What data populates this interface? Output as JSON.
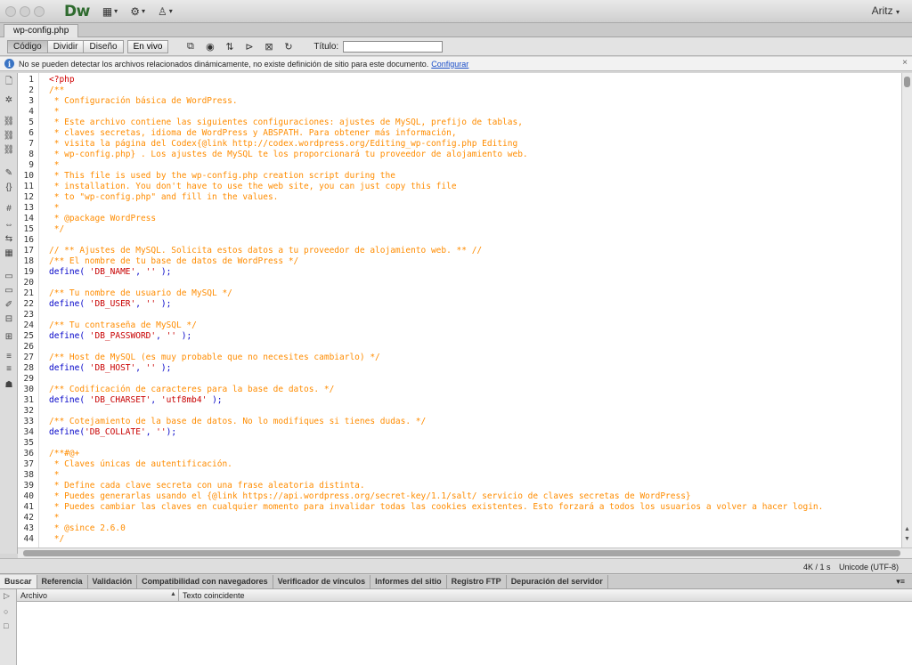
{
  "app": {
    "logo": "Dw",
    "user": "Aritz",
    "menu_glyphs": [
      "▦",
      "⚙",
      "♙"
    ],
    "caret": "▾"
  },
  "document_tab": "wp-config.php",
  "toolbar": {
    "views": [
      "Código",
      "Dividir",
      "Diseño"
    ],
    "active_view": "Código",
    "live": "En vivo",
    "title_label": "Título:",
    "title_value": "",
    "icon_glyphs": [
      "⧉",
      "◉",
      "⇅",
      "⊳",
      "⊠",
      "↻"
    ]
  },
  "infobar": {
    "icon": "i",
    "message": "No se pueden detectar los archivos relacionados dinámicamente, no existe definición de sitio para este documento.",
    "link": "Configurar",
    "close": "×"
  },
  "code_lines": [
    {
      "n": "1",
      "t": "<?php",
      "k": "php"
    },
    {
      "n": "2",
      "t": "/**",
      "k": "comment"
    },
    {
      "n": "3",
      "t": " * Configuración básica de WordPress.",
      "k": "comment"
    },
    {
      "n": "4",
      "t": " *",
      "k": "comment"
    },
    {
      "n": "5",
      "t": " * Este archivo contiene las siguientes configuraciones: ajustes de MySQL, prefijo de tablas,",
      "k": "comment"
    },
    {
      "n": "6",
      "t": " * claves secretas, idioma de WordPress y ABSPATH. Para obtener más información,",
      "k": "comment"
    },
    {
      "n": "7",
      "t": " * visita la página del Codex{@link http://codex.wordpress.org/Editing_wp-config.php Editing",
      "k": "comment"
    },
    {
      "n": "8",
      "t": " * wp-config.php} . Los ajustes de MySQL te los proporcionará tu proveedor de alojamiento web.",
      "k": "comment"
    },
    {
      "n": "9",
      "t": " *",
      "k": "comment"
    },
    {
      "n": "10",
      "t": " * This file is used by the wp-config.php creation script during the",
      "k": "comment"
    },
    {
      "n": "11",
      "t": " * installation. You don't have to use the web site, you can just copy this file",
      "k": "comment"
    },
    {
      "n": "12",
      "t": " * to \"wp-config.php\" and fill in the values.",
      "k": "comment"
    },
    {
      "n": "13",
      "t": " *",
      "k": "comment"
    },
    {
      "n": "14",
      "t": " * @package WordPress",
      "k": "comment"
    },
    {
      "n": "15",
      "t": " */",
      "k": "comment"
    },
    {
      "n": "16",
      "t": "",
      "k": "plain"
    },
    {
      "n": "17",
      "t": "// ** Ajustes de MySQL. Solicita estos datos a tu proveedor de alojamiento web. ** //",
      "k": "comment"
    },
    {
      "n": "18",
      "t": "/** El nombre de tu base de datos de WordPress */",
      "k": "comment"
    },
    {
      "n": "19",
      "t": "define( 'DB_NAME', '' );",
      "k": "define"
    },
    {
      "n": "20",
      "t": "",
      "k": "plain"
    },
    {
      "n": "21",
      "t": "/** Tu nombre de usuario de MySQL */",
      "k": "comment"
    },
    {
      "n": "22",
      "t": "define( 'DB_USER', '' );",
      "k": "define"
    },
    {
      "n": "23",
      "t": "",
      "k": "plain"
    },
    {
      "n": "24",
      "t": "/** Tu contraseña de MySQL */",
      "k": "comment"
    },
    {
      "n": "25",
      "t": "define( 'DB_PASSWORD', '' );",
      "k": "define"
    },
    {
      "n": "26",
      "t": "",
      "k": "plain"
    },
    {
      "n": "27",
      "t": "/** Host de MySQL (es muy probable que no necesites cambiarlo) */",
      "k": "comment"
    },
    {
      "n": "28",
      "t": "define( 'DB_HOST', '' );",
      "k": "define"
    },
    {
      "n": "29",
      "t": "",
      "k": "plain"
    },
    {
      "n": "30",
      "t": "/** Codificación de caracteres para la base de datos. */",
      "k": "comment"
    },
    {
      "n": "31",
      "t": "define( 'DB_CHARSET', 'utf8mb4' );",
      "k": "define"
    },
    {
      "n": "32",
      "t": "",
      "k": "plain"
    },
    {
      "n": "33",
      "t": "/** Cotejamiento de la base de datos. No lo modifiques si tienes dudas. */",
      "k": "comment"
    },
    {
      "n": "34",
      "t": "define('DB_COLLATE', '');",
      "k": "define"
    },
    {
      "n": "35",
      "t": "",
      "k": "plain"
    },
    {
      "n": "36",
      "t": "/**#@+",
      "k": "comment"
    },
    {
      "n": "37",
      "t": " * Claves únicas de autentificación.",
      "k": "comment"
    },
    {
      "n": "38",
      "t": " *",
      "k": "comment"
    },
    {
      "n": "39",
      "t": " * Define cada clave secreta con una frase aleatoria distinta.",
      "k": "comment"
    },
    {
      "n": "40",
      "t": " * Puedes generarlas usando el {@link https://api.wordpress.org/secret-key/1.1/salt/ servicio de claves secretas de WordPress}",
      "k": "comment"
    },
    {
      "n": "41",
      "t": " * Puedes cambiar las claves en cualquier momento para invalidar todas las cookies existentes. Esto forzará a todos los usuarios a volver a hacer login.",
      "k": "comment"
    },
    {
      "n": "42",
      "t": " *",
      "k": "comment"
    },
    {
      "n": "43",
      "t": " * @since 2.6.0",
      "k": "comment"
    },
    {
      "n": "44",
      "t": " */",
      "k": "comment"
    }
  ],
  "status": {
    "size": "4K / 1 s",
    "encoding": "Unicode (UTF-8)"
  },
  "panel_tabs": [
    "Buscar",
    "Referencia",
    "Validación",
    "Compatibilidad con navegadores",
    "Verificador de vínculos",
    "Informes del sitio",
    "Registro FTP",
    "Depuración del servidor"
  ],
  "active_panel_tab": "Buscar",
  "panel_menu": "▾≡",
  "results": {
    "col_file": "Archivo",
    "col_sort": "▲",
    "col_text": "Texto coincidente",
    "tools": [
      "▷",
      "○",
      "□"
    ]
  },
  "left_tools": [
    "🗋",
    "✲",
    "⛓",
    "⛓",
    "⛓",
    "✎",
    "{}",
    "#",
    "⇔",
    "⇆",
    "▦",
    "▭",
    "▭",
    "✐",
    "⊟",
    "⊞",
    "≡",
    "≡",
    "☗"
  ],
  "scrollbar": {
    "up": "▲",
    "down": "▼"
  },
  "colors": {
    "php": "#d00000",
    "comment": "#ff8c00",
    "function": "#0000c8",
    "string": "#c80000",
    "link": "#1a4ec9"
  }
}
